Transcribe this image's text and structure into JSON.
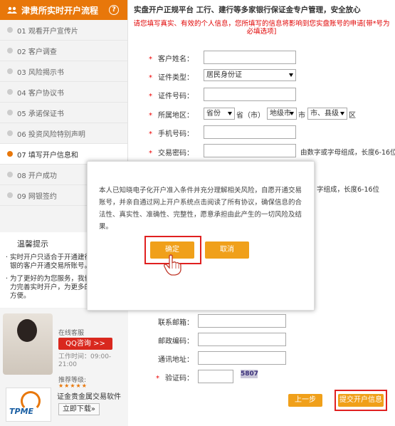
{
  "sidebar": {
    "title": "津贵所实时开户流程",
    "steps": [
      {
        "label": "01  观看开户宣传片",
        "active": false
      },
      {
        "label": "02  客户调查",
        "active": false
      },
      {
        "label": "03  风险揭示书",
        "active": false
      },
      {
        "label": "04  客户协议书",
        "active": false
      },
      {
        "label": "05  承诺保证书",
        "active": false
      },
      {
        "label": "06  投资风险特别声明",
        "active": false
      },
      {
        "label": "07  填写开户信息和",
        "active": true
      },
      {
        "label": "08  开户成功",
        "active": false
      },
      {
        "label": "09  网银签约",
        "active": false
      }
    ],
    "tips_title": "温馨提示",
    "tips": [
      "· 实时开户只适合于开通建行、工行网银的客户开通交易所账号。",
      "· 为了更好的为您服务，我们尽最大能力完善实时开户，为更多的用户带来方便。"
    ],
    "service": {
      "online_label": "在线客服",
      "qq_button": "QQ咨询 >>",
      "hours": "工作时间：09:00-21:00",
      "recommend": "推荐等级:",
      "stars": "★★★★★",
      "software": "证金贵金属交易软件",
      "logo_text": "TPME",
      "download": "立即下载»"
    }
  },
  "main": {
    "title": "实盘开户正规平台  工行、建行等多家银行保证金专户管理，安全放心",
    "warning": "请您填写真实、有效的个人信息，您所填写的信息将影响到您实盘账号的申请[带*号为必填选项]",
    "labels": {
      "name": "客户姓名：",
      "id_type": "证件类型：",
      "id_number": "证件号码：",
      "region": "所属地区：",
      "mobile": "手机号码：",
      "trade_pwd": "交易密码：",
      "email": "联系邮箱：",
      "zip": "邮政编码：",
      "address": "通讯地址：",
      "captcha": "验证码："
    },
    "id_type_value": "居民身份证",
    "province_value": "省份",
    "province_suffix": "省（市）",
    "city_value": "地级市",
    "city_suffix": "市",
    "county_value": "市、县级",
    "county_suffix": "区",
    "pwd_hint": "由数字或字母组成，长度6-16位",
    "pwd_hint2": "字组成，长度6-16位",
    "captcha_text": "5807",
    "prev_button": "上一步",
    "submit_button": "提交开户信息"
  },
  "modal": {
    "message": "本人已知晓电子化开户准入条件并充分理解相关风险，自愿开通交易账号，并亲自通过网上开户系统点击阅读了所有协议，确保信息的合法性、真实性、准确性、完整性，愿意承担由此产生的一切风险及结果。",
    "confirm": "确定",
    "cancel": "取消"
  },
  "colors": {
    "accent": "#e8770a",
    "button": "#f0a01a",
    "warning": "#e00000",
    "highlight": "#e02020"
  }
}
